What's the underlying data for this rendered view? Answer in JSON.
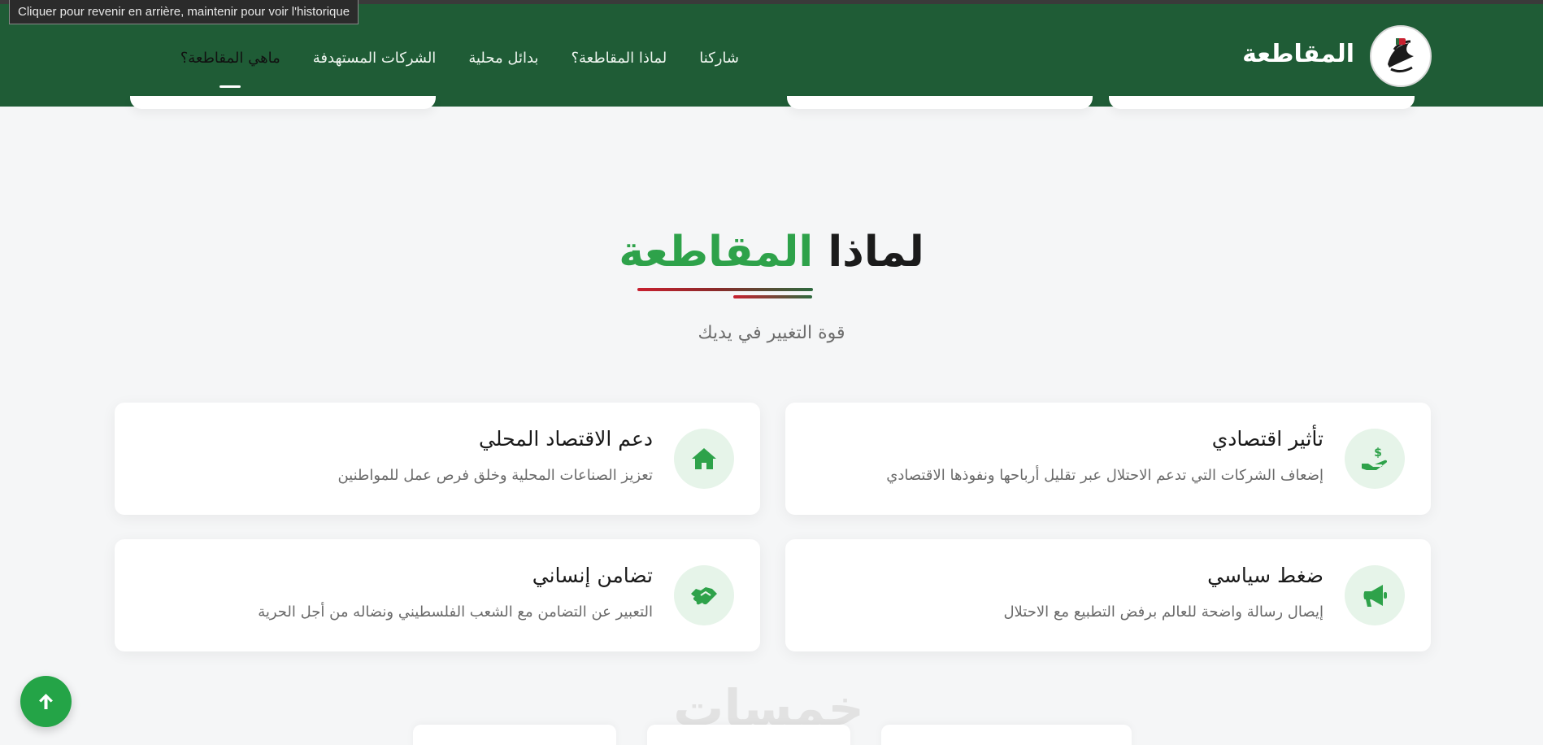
{
  "tooltip": "Cliquer pour revenir en arrière, maintenir pour voir l'historique",
  "header": {
    "brand": "المقاطعة",
    "logo_icon": "boycott-logo-icon",
    "nav": [
      {
        "label": "ماهي المقاطعة؟",
        "active": true
      },
      {
        "label": "الشركات المستهدفة",
        "active": false
      },
      {
        "label": "بدائل محلية",
        "active": false
      },
      {
        "label": "لماذا المقاطعة؟",
        "active": false
      },
      {
        "label": "شاركنا",
        "active": false
      }
    ]
  },
  "section": {
    "title_dark": "لماذا",
    "title_green": "المقاطعة",
    "subtitle": "قوة التغيير في يديك"
  },
  "cards": [
    {
      "title": "تأثير اقتصادي",
      "desc": "إضعاف الشركات التي تدعم الاحتلال عبر تقليل أرباحها ونفوذها الاقتصادي",
      "icon": "hand-dollar-icon"
    },
    {
      "title": "دعم الاقتصاد المحلي",
      "desc": "تعزيز الصناعات المحلية وخلق فرص عمل للمواطنين",
      "icon": "home-icon"
    },
    {
      "title": "ضغط سياسي",
      "desc": "إيصال رسالة واضحة للعالم برفض التطبيع مع الاحتلال",
      "icon": "megaphone-icon"
    },
    {
      "title": "تضامن إنساني",
      "desc": "التعبير عن التضامن مع الشعب الفلسطيني ونضاله من أجل الحرية",
      "icon": "handshake-icon"
    }
  ],
  "watermark": "خمسات",
  "colors": {
    "header_bg": "#1f5c36",
    "accent_green": "#2ea24a",
    "icon_bg": "#e6f4e9",
    "scroll_button": "#24a447"
  }
}
